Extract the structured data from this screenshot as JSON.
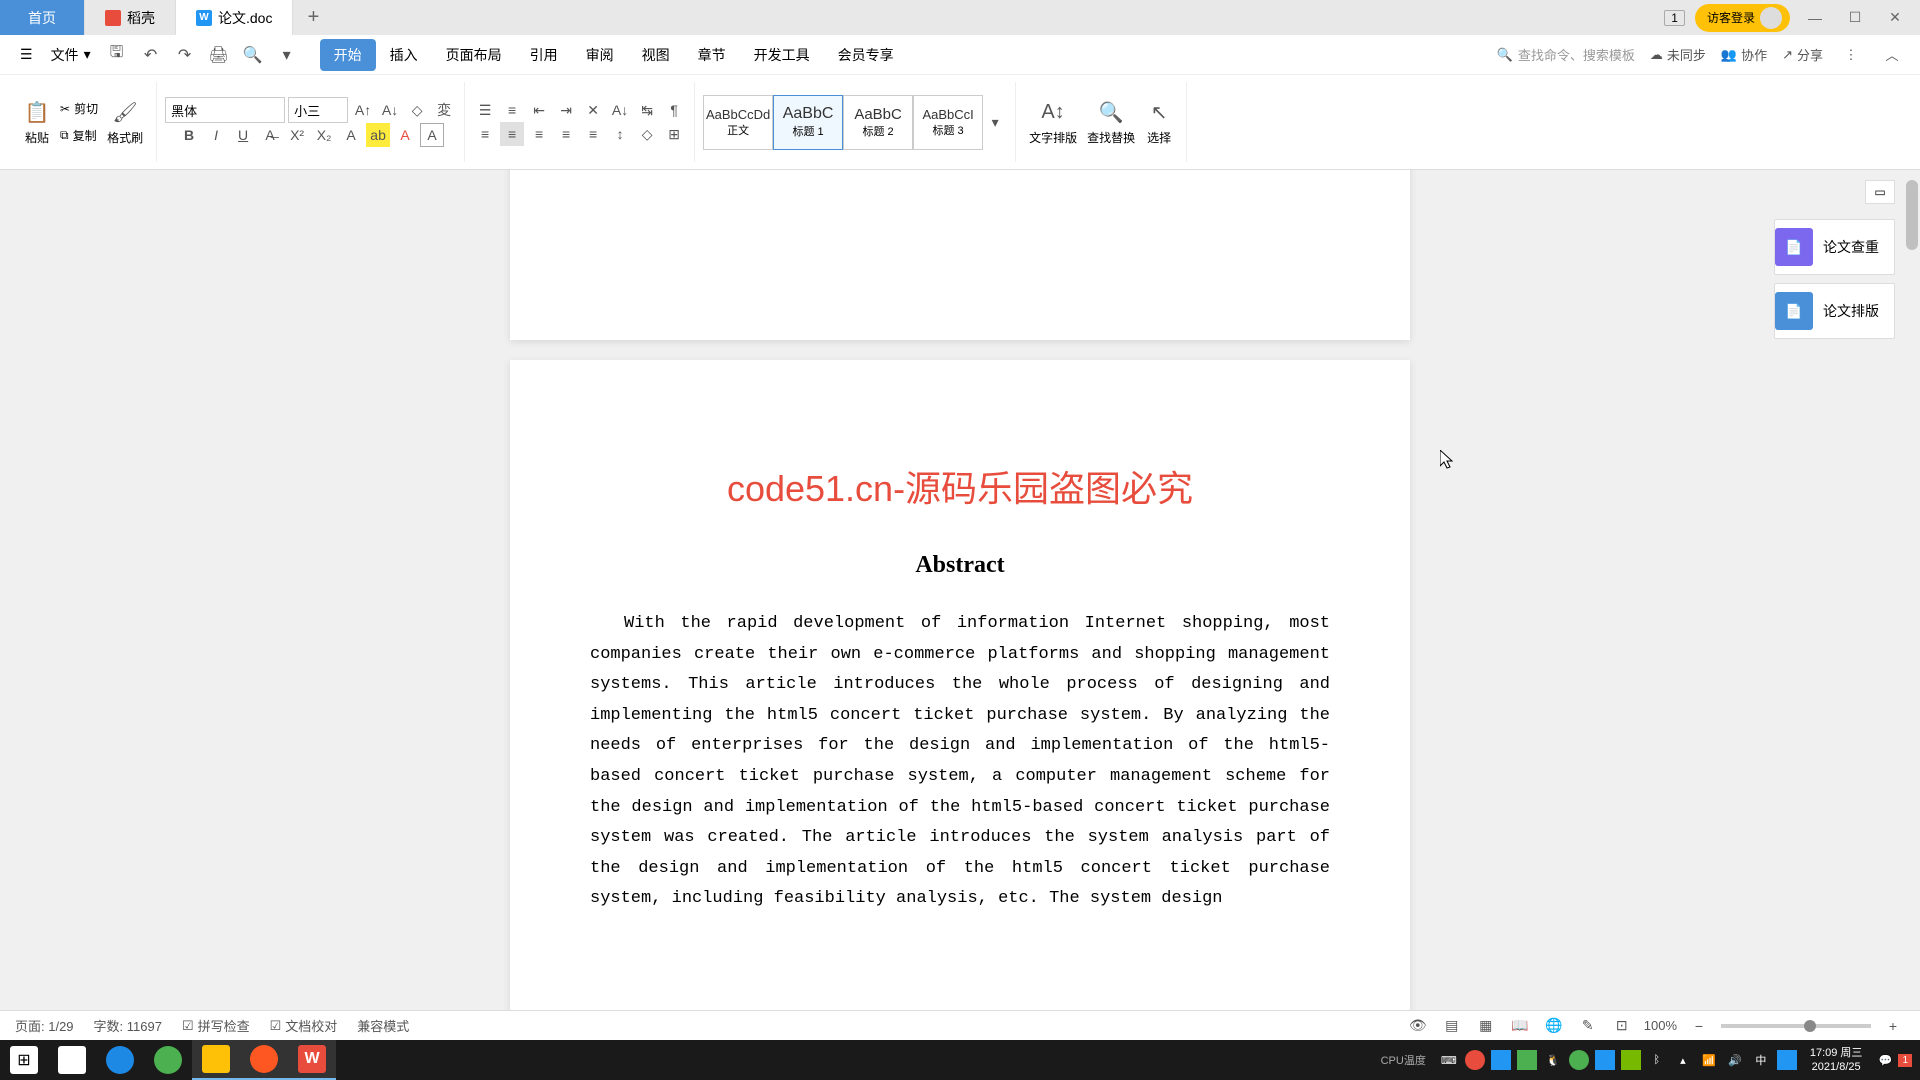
{
  "titlebar": {
    "home_tab": "首页",
    "tab2": "稻壳",
    "tab3": "论文.doc",
    "tab_count": "1",
    "login": "访客登录"
  },
  "menubar": {
    "file": "文件",
    "tabs": [
      "开始",
      "插入",
      "页面布局",
      "引用",
      "审阅",
      "视图",
      "章节",
      "开发工具",
      "会员专享"
    ],
    "search_placeholder": "查找命令、搜索模板",
    "unsync": "未同步",
    "collab": "协作",
    "share": "分享"
  },
  "ribbon": {
    "paste": "粘贴",
    "cut": "剪切",
    "copy": "复制",
    "format_painter": "格式刷",
    "font_name": "黑体",
    "font_size": "小三",
    "styles": {
      "normal": "正文",
      "h1": "标题 1",
      "h2": "标题 2",
      "h3": "标题 3",
      "sample": "AaBbC",
      "sample_long": "AaBbCcDd",
      "sample_i": "AaBbCcI"
    },
    "text_layout": "文字排版",
    "find_replace": "查找替换",
    "select": "选择"
  },
  "sidepanel": {
    "item1": "论文查重",
    "item2": "论文排版"
  },
  "document": {
    "watermark_red": "code51.cn-源码乐园盗图必究",
    "watermark_bg": "code51.cn",
    "abstract_title": "Abstract",
    "abstract_body": "With the rapid development of information Internet shopping, most companies create their own e-commerce platforms and shopping management systems. This article introduces the whole process of designing and implementing the html5 concert ticket purchase system. By analyzing the needs of enterprises for the design and implementation of the html5-based concert ticket purchase system, a computer management scheme for the design and implementation of the html5-based concert ticket purchase system was created. The article introduces the system analysis part of the design and implementation of the html5 concert ticket purchase system, including feasibility analysis, etc. The system design"
  },
  "statusbar": {
    "page": "页面: 1/29",
    "words": "字数: 11697",
    "spellcheck": "拼写检查",
    "doccheck": "文档校对",
    "compat": "兼容模式",
    "zoom": "100%"
  },
  "taskbar": {
    "cpu": "CPU温度",
    "time": "17:09 周三",
    "date": "2021/8/25",
    "notif": "1"
  }
}
